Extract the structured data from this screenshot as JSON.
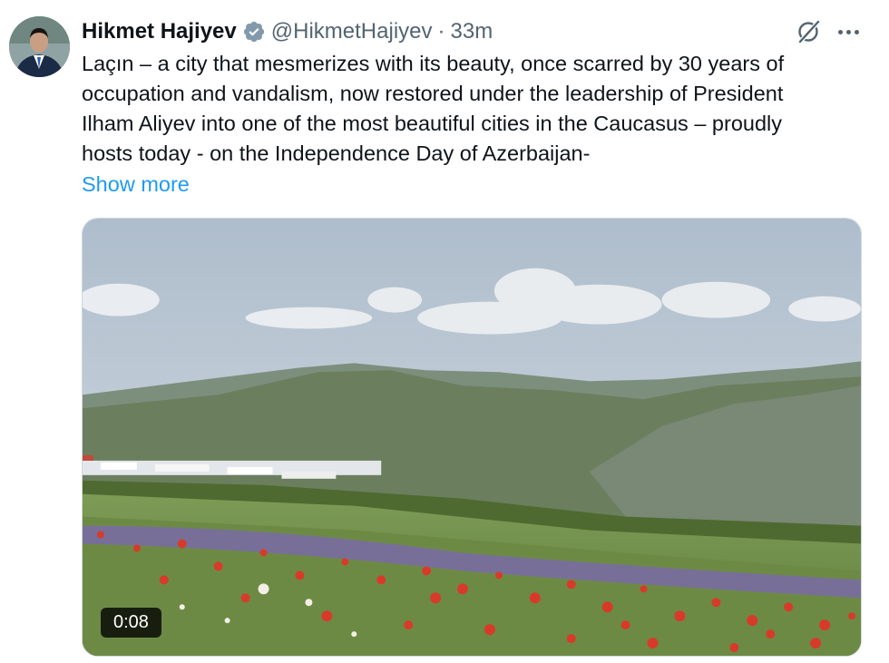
{
  "tweet": {
    "author_name": "Hikmet Hajiyev",
    "handle": "@HikmetHajiyev",
    "separator": "·",
    "time": "33m",
    "text_lines": [
      "Laçın – a city that mesmerizes with its beauty, once scarred by 30 years of",
      "occupation and vandalism, now restored under the leadership of President",
      "Ilham Aliyev into one of the most beautiful cities in the Caucasus – proudly",
      "hosts today - on the Independence Day of Azerbaijan-"
    ],
    "show_more": "Show more",
    "video_duration": "0:08"
  },
  "icons": {
    "verified": "verified-badge-icon",
    "grok": "grok-icon",
    "more": "more-options-icon"
  },
  "colors": {
    "link": "#1d9bf0",
    "secondary_text": "#536471",
    "verified_badge": "#829aab"
  }
}
